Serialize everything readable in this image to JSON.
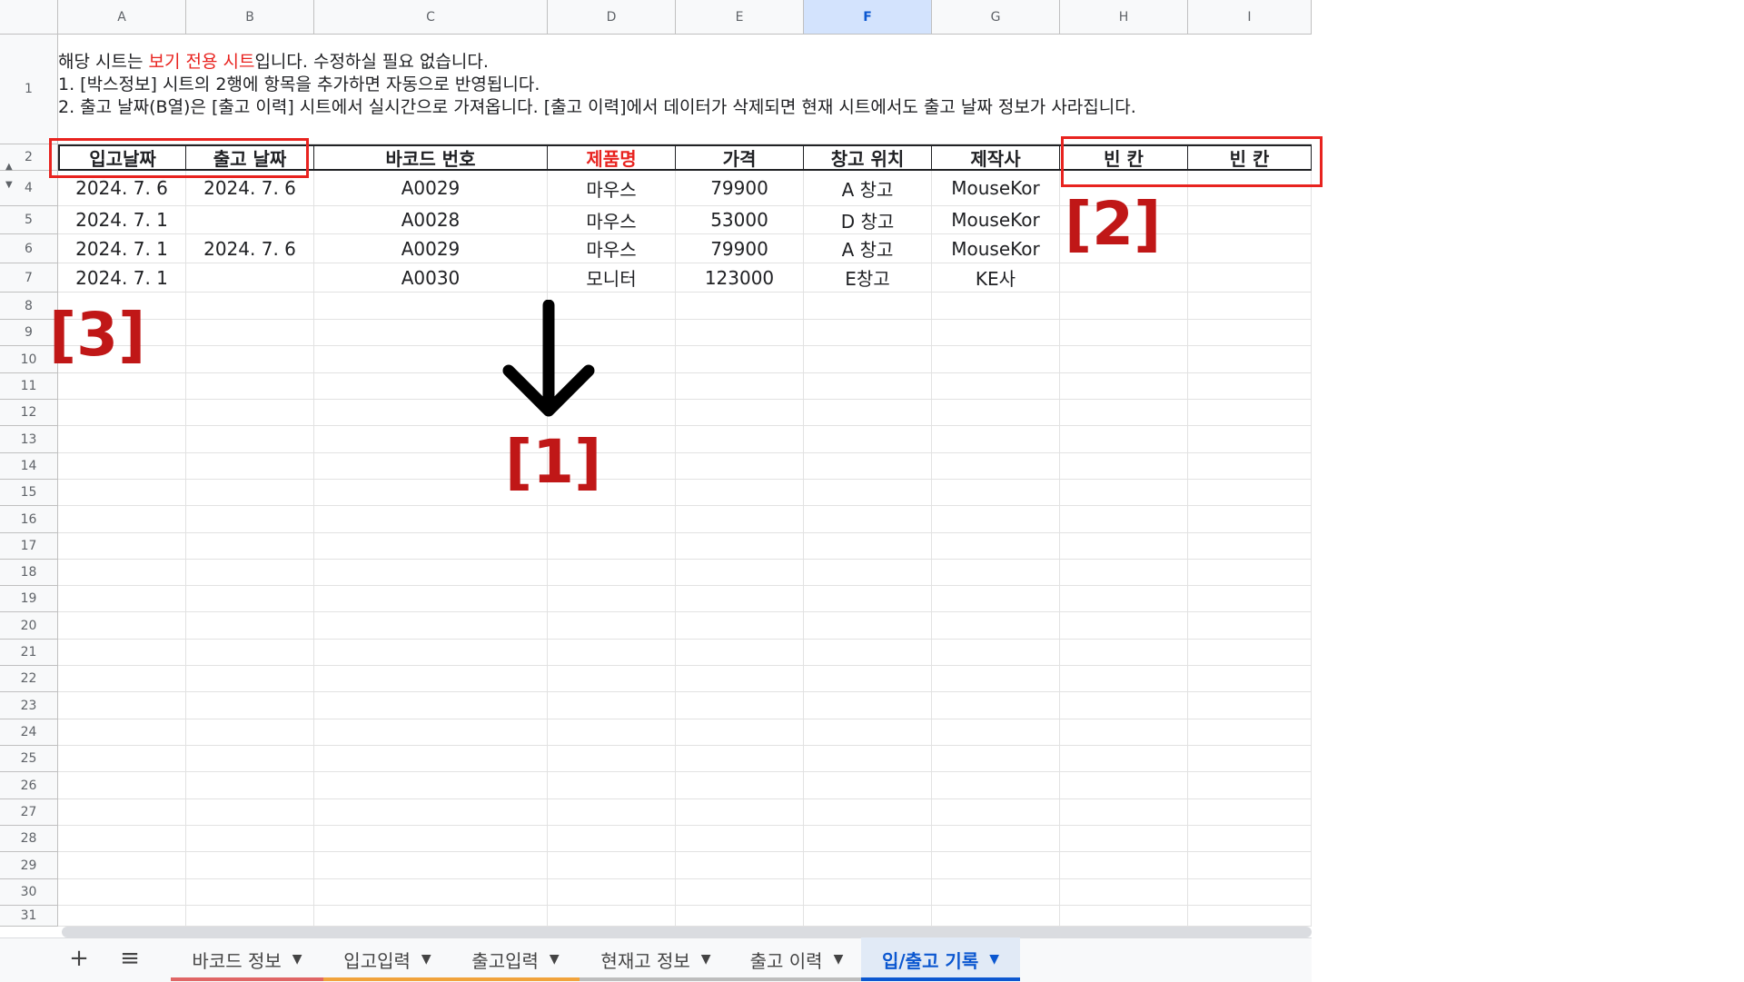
{
  "colors": {
    "accent_red": "#e8231f",
    "active_tab": "#0b57d0"
  },
  "columns": [
    "A",
    "B",
    "C",
    "D",
    "E",
    "F",
    "G",
    "H",
    "I"
  ],
  "selected_column": "F",
  "row_numbers": [
    "1",
    "2",
    "4",
    "5",
    "6",
    "7",
    "8",
    "9",
    "10",
    "11",
    "12",
    "13",
    "14",
    "15",
    "16",
    "17",
    "18",
    "19",
    "20",
    "21",
    "22",
    "23",
    "24",
    "25",
    "26",
    "27",
    "28",
    "29",
    "30",
    "31"
  ],
  "note": {
    "line1_prefix": "해당 시트는 ",
    "line1_red": "보기 전용 시트",
    "line1_suffix": "입니다. 수정하실 필요 없습니다.",
    "line2": "1. [박스정보] 시트의 2행에 항목을 추가하면 자동으로 반영됩니다.",
    "line3": "2. 출고 날짜(B열)은 [출고 이력] 시트에서 실시간으로 가져옵니다. [출고 이력]에서 데이터가 삭제되면 현재 시트에서도 출고 날짜 정보가 사라집니다."
  },
  "table": {
    "headers": [
      "입고날짜",
      "출고 날짜",
      "바코드 번호",
      "제품명",
      "가격",
      "창고 위치",
      "제작사",
      "빈 칸",
      "빈 칸"
    ],
    "rows": [
      [
        "2024. 7. 6",
        "2024. 7. 6",
        "A0029",
        "마우스",
        "79900",
        "A 창고",
        "MouseKor",
        "",
        ""
      ],
      [
        "2024. 7. 1",
        "",
        "A0028",
        "마우스",
        "53000",
        "D 창고",
        "MouseKor",
        "",
        ""
      ],
      [
        "2024. 7. 1",
        "2024. 7. 6",
        "A0029",
        "마우스",
        "79900",
        "A 창고",
        "MouseKor",
        "",
        ""
      ],
      [
        "2024. 7. 1",
        "",
        "A0030",
        "모니터",
        "123000",
        "E창고",
        "KE사",
        "",
        ""
      ]
    ]
  },
  "annotations": {
    "label1": "[1]",
    "label2": "[2]",
    "label3": "[3]"
  },
  "tabs": [
    {
      "label": "바코드 정보",
      "color": "#e06666"
    },
    {
      "label": "입고입력",
      "color": "#f1a33c"
    },
    {
      "label": "출고입력",
      "color": "#f1a33c"
    },
    {
      "label": "현재고 정보",
      "color": "#bdbdbd"
    },
    {
      "label": "출고 이력",
      "color": "#bdbdbd"
    },
    {
      "label": "입/출고 기록",
      "color": "#0b57d0"
    }
  ],
  "active_tab": 5,
  "tab_controls": {
    "add": "+",
    "menu": "≡"
  }
}
